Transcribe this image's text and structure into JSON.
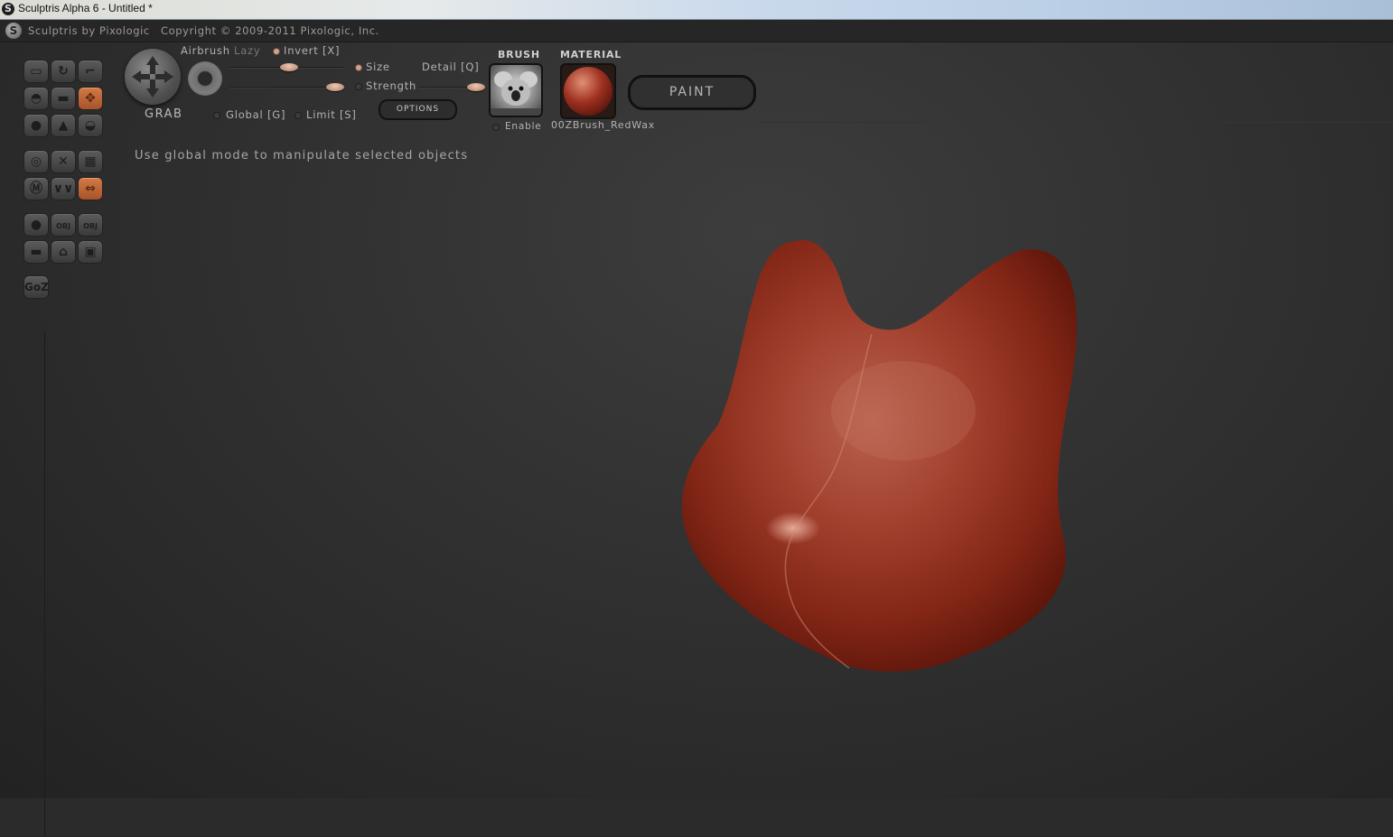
{
  "window": {
    "title": "Sculptris Alpha 6 - Untitled *",
    "app_icon": "sculptris-logo-icon"
  },
  "header": {
    "app_name": "Sculptris by Pixologic",
    "copyright": "Copyright © 2009-2011 Pixologic, Inc."
  },
  "toolbar": {
    "tools": [
      {
        "name": "draw",
        "icon": "draw-icon"
      },
      {
        "name": "rotate",
        "icon": "rotate-icon"
      },
      {
        "name": "crop",
        "icon": "crop-icon"
      },
      {
        "name": "inflate",
        "icon": "inflate-icon"
      },
      {
        "name": "flatten",
        "icon": "flatten-icon"
      },
      {
        "name": "grab",
        "icon": "grab-icon",
        "active": true
      },
      {
        "name": "pinch",
        "icon": "pinch-icon"
      },
      {
        "name": "crease",
        "icon": "crease-icon"
      },
      {
        "name": "smooth",
        "icon": "smooth-icon"
      },
      {
        "name": "symmetry",
        "icon": "symmetry-icon"
      },
      {
        "name": "reduce",
        "icon": "reduce-icon"
      },
      {
        "name": "wireframe",
        "icon": "wireframe-icon"
      },
      {
        "name": "material",
        "icon": "material-icon"
      },
      {
        "name": "subdivide",
        "icon": "subdivide-icon"
      },
      {
        "name": "mirror",
        "icon": "mirror-icon",
        "active": true
      },
      {
        "name": "new-sphere",
        "icon": "sphere-icon"
      },
      {
        "name": "import-obj",
        "icon": "obj-import-icon",
        "label": "OBJ"
      },
      {
        "name": "export-obj",
        "icon": "obj-export-icon",
        "label": "OBJ"
      },
      {
        "name": "new-plane",
        "icon": "plane-icon"
      },
      {
        "name": "open",
        "icon": "open-icon"
      },
      {
        "name": "save",
        "icon": "save-icon"
      }
    ],
    "goz_label": "GoZ"
  },
  "brush": {
    "tool_name": "GRAB",
    "airbrush_label": "Airbrush",
    "lazy_label": "Lazy",
    "invert_label": "Invert [X]",
    "size_label": "Size",
    "strength_label": "Strength",
    "detail_label": "Detail [Q]",
    "global_label": "Global [G]",
    "limit_label": "Limit [S]",
    "options_label": "OPTIONS",
    "size_value": 0.52,
    "strength_value": 0.93,
    "detail_value": 0.9,
    "invert_on": true
  },
  "brush_panel": {
    "title": "BRUSH",
    "enable_label": "Enable"
  },
  "material_panel": {
    "title": "MATERIAL",
    "name": "00ZBrush_RedWax"
  },
  "paint_label": "PAINT",
  "hint": "Use global mode to manipulate selected objects",
  "colors": {
    "accent": "#c86a3c",
    "model": "#9e3a2a",
    "background": "#2e2e2e"
  }
}
